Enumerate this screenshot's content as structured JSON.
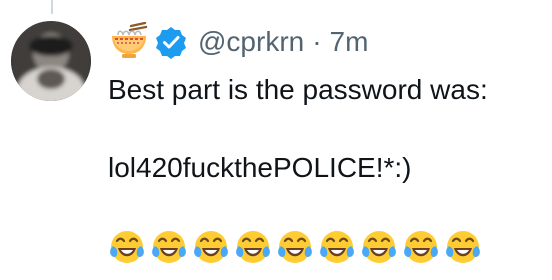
{
  "post": {
    "handle": "@cprkrn",
    "separator": "·",
    "timestamp": "7m",
    "line_1": "Best part is the password was:",
    "line_2": "lol420fuckthePOLICE!*:)",
    "emoji_count": 9,
    "emoji_name": "face-with-tears-of-joy",
    "badge_name": "verified-badge",
    "name_icon": "noodle-bowl",
    "colors": {
      "handle": "#536471",
      "text": "#0f1419",
      "verified": "#1d9bf0",
      "thread_line": "#cfd9de"
    }
  }
}
